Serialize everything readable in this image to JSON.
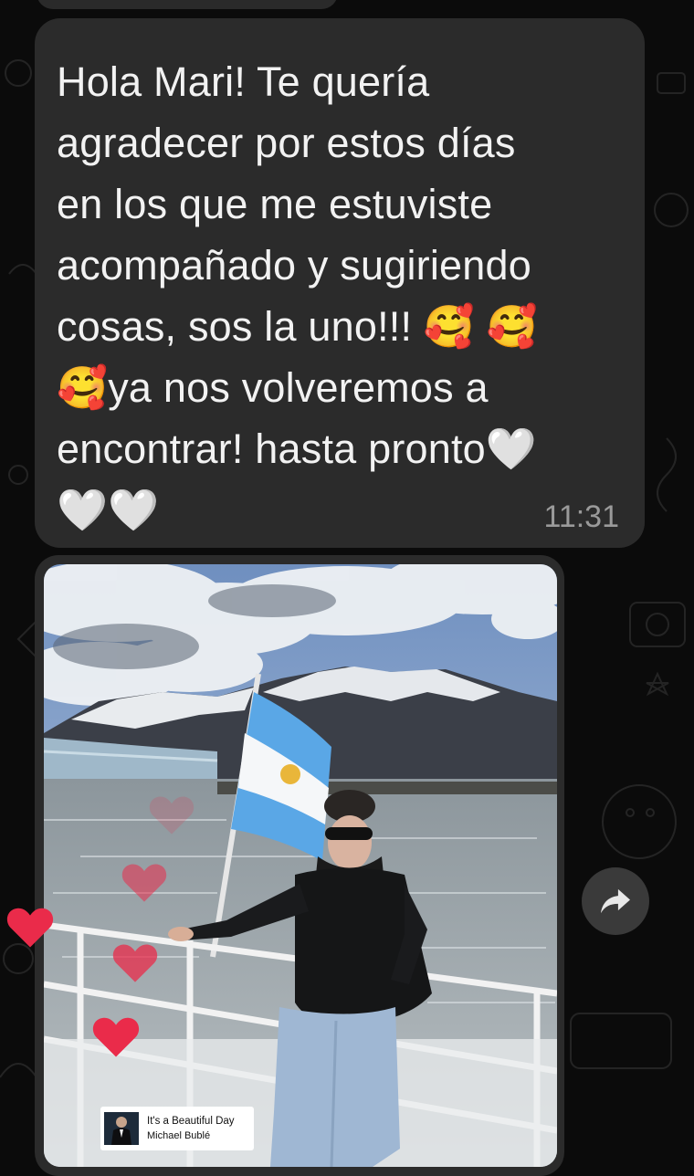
{
  "message": {
    "text": "Hola Mari! Te quería\nagradecer por estos días\nen los que me estuviste\nacompañado y sugiriendo\ncosas, sos la uno!!! 🥰 🥰\n🥰ya nos volveremos a\nencontrar! hasta pronto🤍\n🤍🤍",
    "time": "11:31"
  },
  "media": {
    "music": {
      "song": "It's a Beautiful Day",
      "artist": "Michael Bublé"
    }
  },
  "icons": {
    "forward": "share-forward-icon",
    "hearts": "heart-sticker-icon"
  },
  "colors": {
    "background": "#0b0b0b",
    "bubble": "#2b2b2b",
    "text": "#f2f2f2",
    "timestamp": "#9a9a9a",
    "heart": "#ea2b4a"
  }
}
